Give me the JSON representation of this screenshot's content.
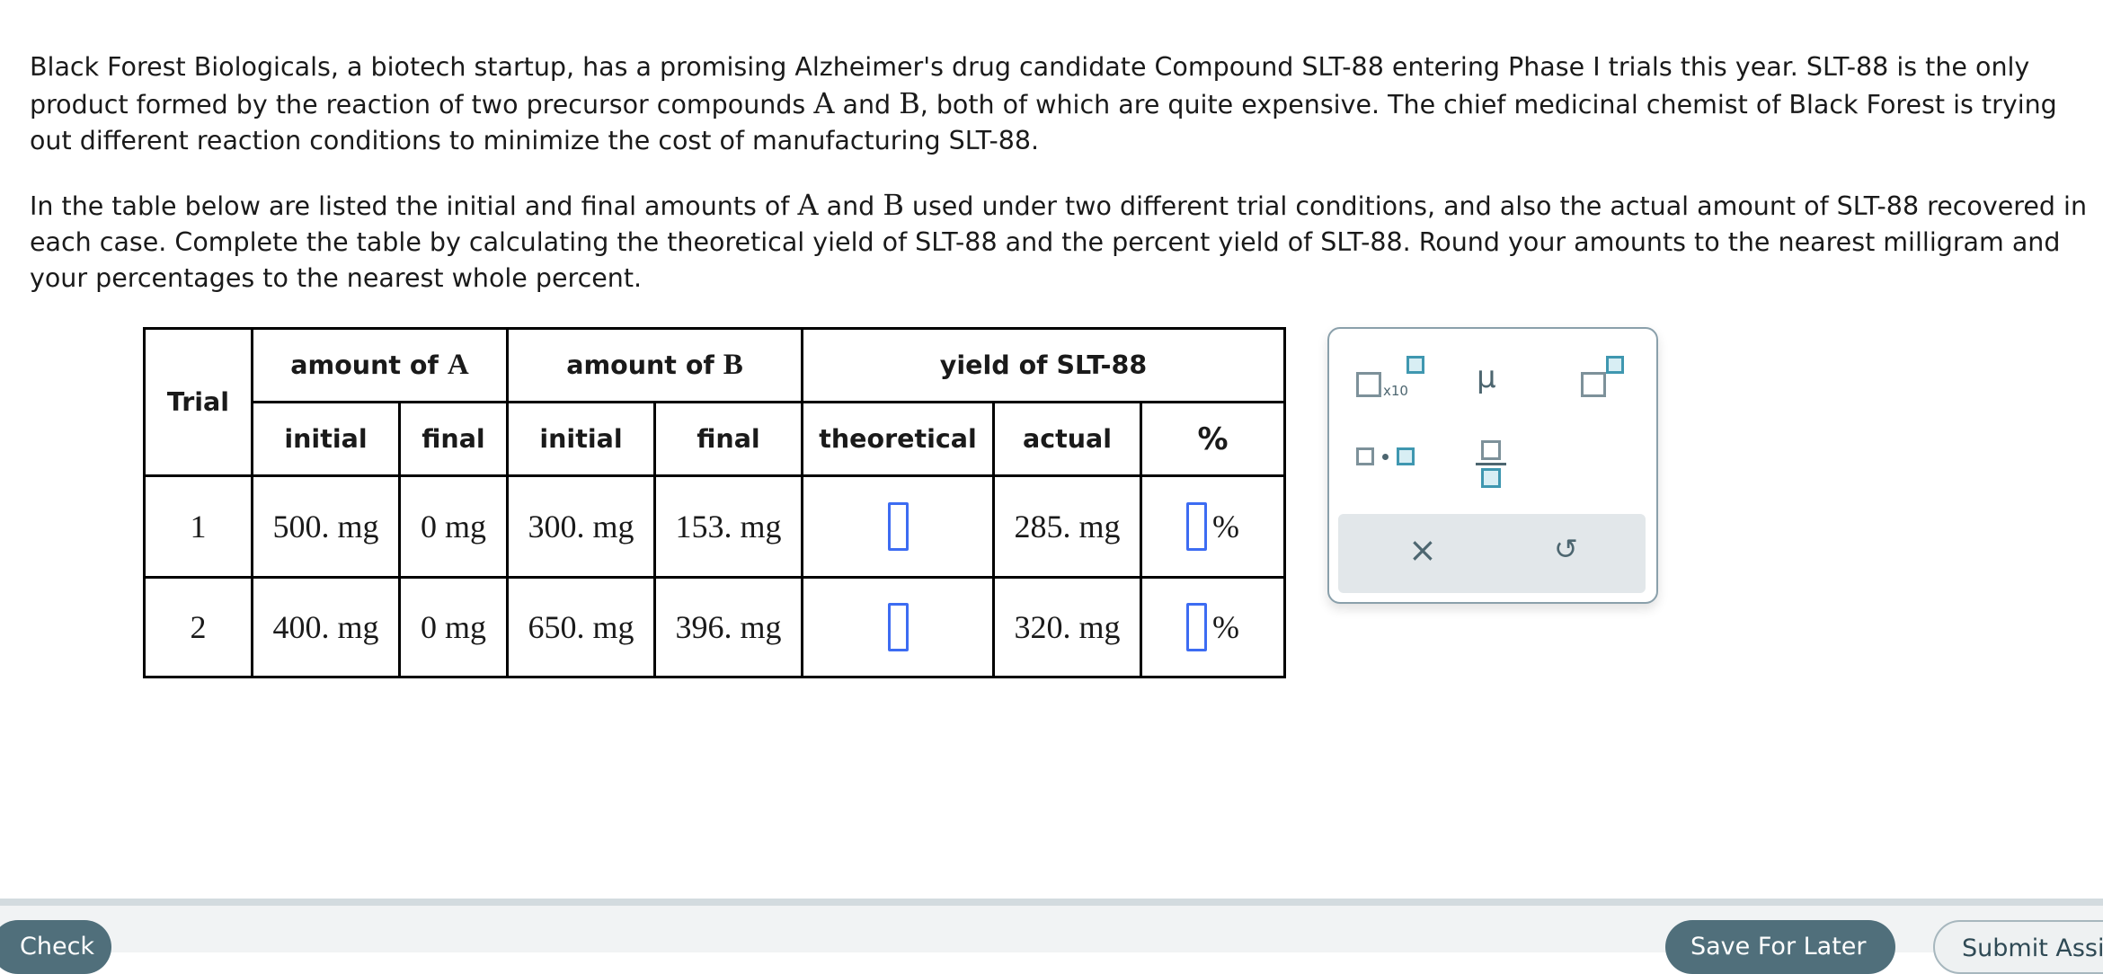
{
  "question": {
    "paragraph1": {
      "part1": "Black Forest Biologicals, a biotech startup, has a promising Alzheimer's drug candidate Compound SLT-88 entering Phase I trials this year. SLT-88 is the only product formed by the reaction of two precursor compounds ",
      "varA": "A",
      "and": " and ",
      "varB": "B",
      "part2": ", both of which are quite expensive. The chief medicinal chemist of Black Forest is trying out different reaction conditions to minimize the cost of manufacturing SLT-88."
    },
    "paragraph2": {
      "part1": "In the table below are listed the initial and final amounts of ",
      "varA": "A",
      "and": " and ",
      "varB": "B",
      "part2": " used under two different trial conditions, and also the actual amount of SLT-88 recovered in each case. Complete the table by calculating the theoretical yield of SLT-88 and the percent yield of SLT-88. Round your amounts to the nearest milligram and your percentages to the nearest whole percent."
    }
  },
  "table": {
    "header_trial": "Trial",
    "header_amount_a_prefix": "amount of ",
    "header_amount_a_var": "A",
    "header_amount_b_prefix": "amount of ",
    "header_amount_b_var": "B",
    "header_yield": "yield of SLT-88",
    "sub_initial": "initial",
    "sub_final": "final",
    "sub_theoretical": "theoretical",
    "sub_actual": "actual",
    "sub_percent": "%",
    "percent_suffix": "%",
    "rows": [
      {
        "trial": "1",
        "a_initial": "500. mg",
        "a_final": "0 mg",
        "b_initial": "300. mg",
        "b_final": "153. mg",
        "theoretical": "",
        "actual": "285. mg",
        "percent": ""
      },
      {
        "trial": "2",
        "a_initial": "400. mg",
        "a_final": "0 mg",
        "b_initial": "650. mg",
        "b_final": "396. mg",
        "theoretical": "",
        "actual": "320. mg",
        "percent": ""
      }
    ]
  },
  "palette": {
    "x10_label": "x10",
    "mu_symbol": "μ",
    "clear_icon": "×",
    "undo_icon": "↺"
  },
  "footer": {
    "check_label": "Check",
    "save_label": "Save For Later",
    "submit_label": "Submit Assignment"
  }
}
